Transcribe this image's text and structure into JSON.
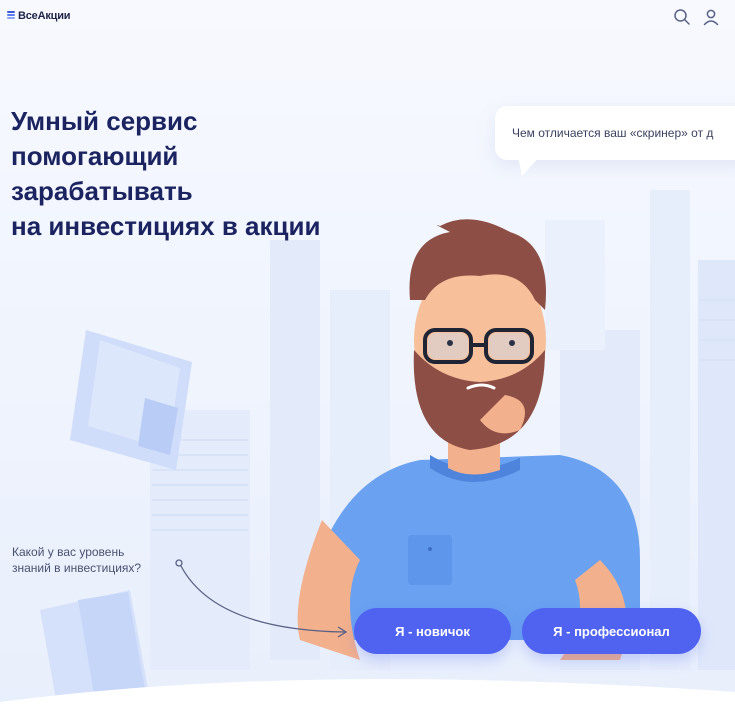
{
  "header": {
    "logo_text": "ВсеАкции",
    "icons": [
      "search-icon",
      "user-icon"
    ]
  },
  "hero": {
    "headline_lines": [
      "Умный сервис",
      "помогающий",
      "зарабатывать",
      "на инвестициях в акции"
    ],
    "bubble_text": "Чем отличается ваш «скринер» от д"
  },
  "quiz": {
    "question": "Какой у вас уровень знаний в инвестициях?",
    "buttons": {
      "novice": "Я - новичок",
      "pro": "Я - профессионал"
    }
  },
  "colors": {
    "headline": "#1b2461",
    "accent": "#4f63f0",
    "background": "#eef3fd"
  }
}
